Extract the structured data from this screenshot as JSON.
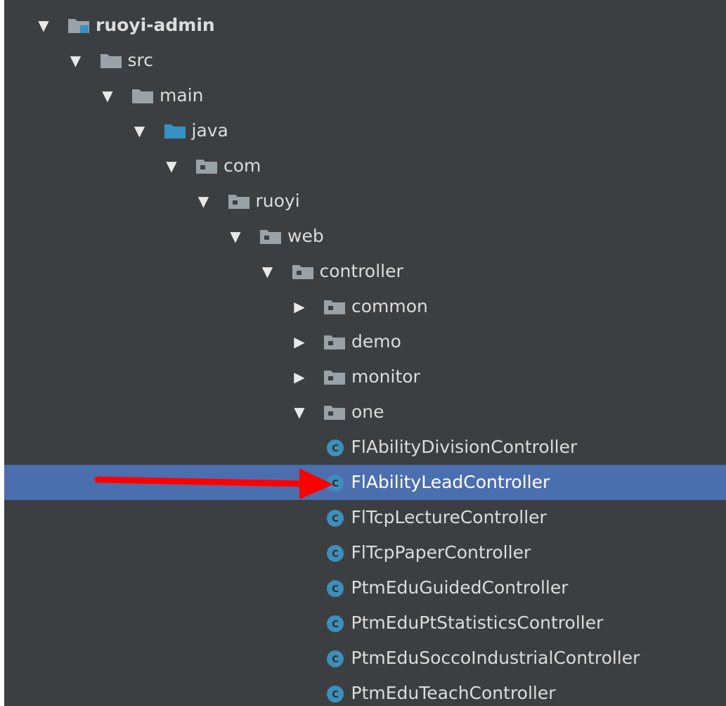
{
  "tree": {
    "rows": [
      {
        "label": "ruoyi-admin",
        "arrow": "down",
        "icon": "module-folder-icon",
        "depth": 0,
        "bold": true
      },
      {
        "label": "src",
        "arrow": "down",
        "icon": "folder-icon",
        "depth": 1
      },
      {
        "label": "main",
        "arrow": "down",
        "icon": "folder-icon",
        "depth": 2
      },
      {
        "label": "java",
        "arrow": "down",
        "icon": "source-folder-icon",
        "depth": 3
      },
      {
        "label": "com",
        "arrow": "down",
        "icon": "package-icon",
        "depth": 4
      },
      {
        "label": "ruoyi",
        "arrow": "down",
        "icon": "package-icon",
        "depth": 5
      },
      {
        "label": "web",
        "arrow": "down",
        "icon": "package-icon",
        "depth": 6
      },
      {
        "label": "controller",
        "arrow": "down",
        "icon": "package-icon",
        "depth": 7
      },
      {
        "label": "common",
        "arrow": "right",
        "icon": "package-icon",
        "depth": 8
      },
      {
        "label": "demo",
        "arrow": "right",
        "icon": "package-icon",
        "depth": 8
      },
      {
        "label": "monitor",
        "arrow": "right",
        "icon": "package-icon",
        "depth": 8
      },
      {
        "label": "one",
        "arrow": "down",
        "icon": "package-icon",
        "depth": 8
      },
      {
        "label": "FlAbilityDivisionController",
        "arrow": "none",
        "icon": "class-icon",
        "depth": 9
      },
      {
        "label": "FlAbilityLeadController",
        "arrow": "none",
        "icon": "class-icon",
        "depth": 9,
        "selected": true
      },
      {
        "label": "FlTcpLectureController",
        "arrow": "none",
        "icon": "class-icon",
        "depth": 9
      },
      {
        "label": "FlTcpPaperController",
        "arrow": "none",
        "icon": "class-icon",
        "depth": 9
      },
      {
        "label": "PtmEduGuidedController",
        "arrow": "none",
        "icon": "class-icon",
        "depth": 9
      },
      {
        "label": "PtmEduPtStatisticsController",
        "arrow": "none",
        "icon": "class-icon",
        "depth": 9
      },
      {
        "label": "PtmEduSoccoIndustrialController",
        "arrow": "none",
        "icon": "class-icon",
        "depth": 9
      },
      {
        "label": "PtmEduTeachController",
        "arrow": "none",
        "icon": "class-icon",
        "depth": 9
      }
    ]
  },
  "class_icon_letter": "C",
  "colors": {
    "background": "#3c3f41",
    "selection": "#4b6eaf",
    "annotation_arrow": "#ff0000",
    "class_icon": "#3d8fba",
    "folder": "#9aa2a8",
    "source_folder": "#3592c4"
  }
}
